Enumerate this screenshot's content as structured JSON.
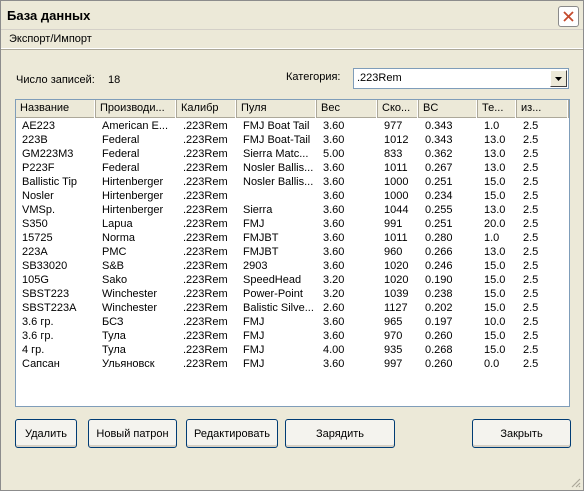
{
  "window": {
    "title": "База данных"
  },
  "menu": {
    "items": [
      "Экспорт/Импорт"
    ]
  },
  "summary": {
    "count_label": "Число записей:",
    "count_value": "18"
  },
  "category": {
    "label": "Категория:",
    "value": ".223Rem"
  },
  "table": {
    "columns": [
      "Название",
      "Производи...",
      "Калибр",
      "Пуля",
      "Вес",
      "Ско...",
      "BC",
      "Те...",
      "из..."
    ],
    "rows": [
      [
        "AE223",
        "American E...",
        ".223Rem",
        "FMJ Boat Tail",
        "3.60",
        "977",
        "0.343",
        "1.0",
        "2.5"
      ],
      [
        "223B",
        "Federal",
        ".223Rem",
        "FMJ Boat-Tail",
        "3.60",
        "1012",
        "0.343",
        "13.0",
        "2.5"
      ],
      [
        "GM223M3",
        "Federal",
        ".223Rem",
        "Sierra Matc...",
        "5.00",
        "833",
        "0.362",
        "13.0",
        "2.5"
      ],
      [
        "P223F",
        "Federal",
        ".223Rem",
        "Nosler Ballis...",
        "3.60",
        "1011",
        "0.267",
        "13.0",
        "2.5"
      ],
      [
        "Ballistic Tip",
        "Hirtenberger",
        ".223Rem",
        "Nosler Ballis...",
        "3.60",
        "1000",
        "0.251",
        "15.0",
        "2.5"
      ],
      [
        "Nosler",
        "Hirtenberger",
        ".223Rem",
        "",
        "3.60",
        "1000",
        "0.234",
        "15.0",
        "2.5"
      ],
      [
        "VMSp.",
        "Hirtenberger",
        ".223Rem",
        "Sierra",
        "3.60",
        "1044",
        "0.255",
        "13.0",
        "2.5"
      ],
      [
        "S350",
        "Lapua",
        ".223Rem",
        "FMJ",
        "3.60",
        "991",
        "0.251",
        "20.0",
        "2.5"
      ],
      [
        "15725",
        "Norma",
        ".223Rem",
        "FMJBT",
        "3.60",
        "1011",
        "0.280",
        "1.0",
        "2.5"
      ],
      [
        "223A",
        "PMC",
        ".223Rem",
        "FMJBT",
        "3.60",
        "960",
        "0.266",
        "13.0",
        "2.5"
      ],
      [
        "SB33020",
        "S&B",
        ".223Rem",
        "2903",
        "3.60",
        "1020",
        "0.246",
        "15.0",
        "2.5"
      ],
      [
        "105G",
        "Sako",
        ".223Rem",
        "SpeedHead",
        "3.20",
        "1020",
        "0.190",
        "15.0",
        "2.5"
      ],
      [
        "SBST223",
        "Winchester",
        ".223Rem",
        "Power-Point",
        "3.20",
        "1039",
        "0.238",
        "15.0",
        "2.5"
      ],
      [
        "SBST223A",
        "Winchester",
        ".223Rem",
        "Balistic Silve...",
        "2.60",
        "1127",
        "0.202",
        "15.0",
        "2.5"
      ],
      [
        "3.6 гр.",
        "БСЗ",
        ".223Rem",
        "FMJ",
        "3.60",
        "965",
        "0.197",
        "10.0",
        "2.5"
      ],
      [
        "3.6 гр.",
        "Тула",
        ".223Rem",
        "FMJ",
        "3.60",
        "970",
        "0.260",
        "15.0",
        "2.5"
      ],
      [
        "4 гр.",
        "Тула",
        ".223Rem",
        "FMJ",
        "4.00",
        "935",
        "0.268",
        "15.0",
        "2.5"
      ],
      [
        "Сапсан",
        "Ульяновск",
        ".223Rem",
        "FMJ",
        "3.60",
        "997",
        "0.260",
        "0.0",
        "2.5"
      ]
    ]
  },
  "buttons": {
    "delete": "Удалить",
    "new": "Новый патрон",
    "edit": "Редактировать",
    "load": "Зарядить",
    "close": "Закрыть"
  }
}
